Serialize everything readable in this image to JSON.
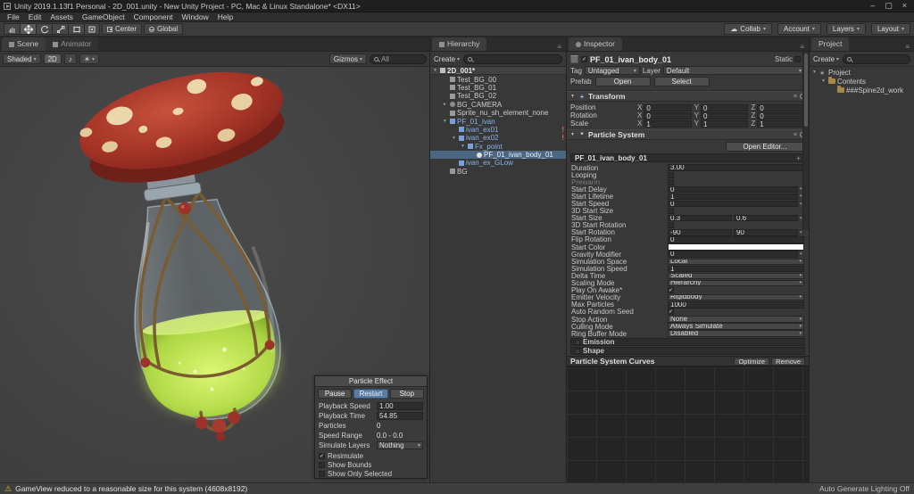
{
  "window": {
    "title": "Unity 2019.1.13f1 Personal - 2D_001.unity - New Unity Project - PC, Mac & Linux Standalone* <DX11>",
    "menus": [
      {
        "label": "File"
      },
      {
        "label": "Edit"
      },
      {
        "label": "Assets"
      },
      {
        "label": "GameObject"
      },
      {
        "label": "Component"
      },
      {
        "label": "Window"
      },
      {
        "label": "Help"
      }
    ],
    "controls": {
      "minimize": "–",
      "maximize": "▢",
      "close": "×"
    }
  },
  "toolbar": {
    "tools": [
      "hand-tool",
      "move-tool",
      "rotate-tool",
      "scale-tool",
      "rect-tool",
      "transform-tool"
    ],
    "pivot_label": "Center",
    "space_label": "Global",
    "collab_label": "Collab",
    "account_label": "Account",
    "layers_label": "Layers",
    "layout_label": "Layout"
  },
  "scene": {
    "tabs": [
      {
        "label": "Scene",
        "active": true
      },
      {
        "label": "Animator",
        "active": false
      }
    ],
    "toolbar": {
      "shading_mode": "Shaded",
      "mode_2d": "2D",
      "gizmos_label": "Gizmos",
      "search_value": "All"
    }
  },
  "particle_effect": {
    "title": "Particle Effect",
    "buttons": [
      {
        "label": "Pause",
        "active": false
      },
      {
        "label": "Restart",
        "active": true
      },
      {
        "label": "Stop",
        "active": false
      }
    ],
    "rows": [
      {
        "label": "Playback Speed",
        "value": "1.00",
        "field": "text"
      },
      {
        "label": "Playback Time",
        "value": "54.85",
        "field": "text"
      },
      {
        "label": "Particles",
        "value": "0",
        "field": "plain"
      },
      {
        "label": "Speed Range",
        "value": "0.0 - 0.0",
        "field": "plain"
      },
      {
        "label": "Simulate Layers",
        "value": "Nothing",
        "field": "dropdown"
      }
    ],
    "checks": [
      {
        "label": "Resimulate",
        "checked": true
      },
      {
        "label": "Show Bounds",
        "checked": false
      },
      {
        "label": "Show Only Selected",
        "checked": false
      }
    ]
  },
  "hierarchy": {
    "tab": "Hierarchy",
    "create_label": "Create",
    "items": [
      {
        "label": "2D_001*",
        "depth": 0,
        "arrow": "down",
        "icon": "scene",
        "type": "scene"
      },
      {
        "label": "Test_BG_00",
        "depth": 1,
        "icon": "go"
      },
      {
        "label": "Test_BG_01",
        "depth": 1,
        "icon": "go"
      },
      {
        "label": "Test_BG_02",
        "depth": 1,
        "icon": "go"
      },
      {
        "label": "BG_CAMERA",
        "depth": 1,
        "arrow": "right",
        "icon": "camera"
      },
      {
        "label": "Sprite_nu_sh_element_none",
        "depth": 1,
        "icon": "go"
      },
      {
        "label": "PF_01_ivan",
        "depth": 1,
        "arrow": "down",
        "icon": "prefab",
        "prefab": true
      },
      {
        "label": "ivan_ex01",
        "depth": 2,
        "icon": "prefab",
        "prefab": true,
        "warning": true
      },
      {
        "label": "ivan_ex02",
        "depth": 2,
        "arrow": "down",
        "icon": "prefab",
        "prefab": true,
        "warning": true
      },
      {
        "label": "Fx_point",
        "depth": 3,
        "arrow": "down",
        "icon": "prefab",
        "prefab": true
      },
      {
        "label": "PF_01_ivan_body_01",
        "depth": 4,
        "icon": "particle",
        "prefab": true,
        "selected": true
      },
      {
        "label": "ivan_ex_GLow",
        "depth": 2,
        "icon": "prefab",
        "prefab": true
      },
      {
        "label": "BG",
        "depth": 1,
        "icon": "go"
      }
    ]
  },
  "inspector": {
    "tab": "Inspector",
    "object_name": "PF_01_ivan_body_01",
    "static_label": "Static",
    "tag_label": "Tag",
    "tag_value": "Untagged",
    "layer_label": "Layer",
    "layer_value": "Default",
    "prefab_label": "Prefab",
    "prefab_buttons": [
      {
        "label": "Open"
      },
      {
        "label": "Select"
      }
    ],
    "transform": {
      "title": "Transform",
      "axes": [
        "X",
        "Y",
        "Z"
      ],
      "rows": [
        {
          "label": "Position",
          "x": "0",
          "y": "0",
          "z": "0"
        },
        {
          "label": "Rotation",
          "x": "0",
          "y": "0",
          "z": "0"
        },
        {
          "label": "Scale",
          "x": "1",
          "y": "1",
          "z": "1"
        }
      ]
    },
    "particle_system": {
      "title": "Particle System",
      "open_editor_label": "Open Editor...",
      "module_title": "PF_01_ivan_body_01",
      "properties": [
        {
          "label": "Duration",
          "type": "text",
          "value": "3.00"
        },
        {
          "label": "Looping",
          "type": "checkbox",
          "checked": false
        },
        {
          "label": "Prewarm",
          "type": "checkbox",
          "checked": false,
          "disabled": true
        },
        {
          "label": "Start Delay",
          "type": "text-arrow",
          "value": "0"
        },
        {
          "label": "Start Lifetime",
          "type": "text-arrow",
          "value": "1"
        },
        {
          "label": "Start Speed",
          "type": "text-arrow",
          "value": "0"
        },
        {
          "label": "3D Start Size",
          "type": "checkbox",
          "checked": false
        },
        {
          "label": "Start Size",
          "type": "two-text-arrow",
          "value": "0.3",
          "value2": "0.6"
        },
        {
          "label": "3D Start Rotation",
          "type": "checkbox",
          "checked": false
        },
        {
          "label": "Start Rotation",
          "type": "two-text-arrow",
          "value": "-90",
          "value2": "90"
        },
        {
          "label": "Flip Rotation",
          "type": "text",
          "value": "0"
        },
        {
          "label": "Start Color",
          "type": "color"
        },
        {
          "label": "Gravity Modifier",
          "type": "text-arrow",
          "value": "0"
        },
        {
          "label": "Simulation Space",
          "type": "dropdown",
          "value": "Local"
        },
        {
          "label": "Simulation Speed",
          "type": "text",
          "value": "1"
        },
        {
          "label": "Delta Time",
          "type": "dropdown",
          "value": "Scaled"
        },
        {
          "label": "Scaling Mode",
          "type": "dropdown",
          "value": "Hierarchy"
        },
        {
          "label": "Play On Awake*",
          "type": "checkbox",
          "checked": true
        },
        {
          "label": "Emitter Velocity",
          "type": "dropdown",
          "value": "Rigidbody"
        },
        {
          "label": "Max Particles",
          "type": "text",
          "value": "1000"
        },
        {
          "label": "Auto Random Seed",
          "type": "checkbox",
          "checked": true
        },
        {
          "label": "Stop Action",
          "type": "dropdown",
          "value": "None"
        },
        {
          "label": "Culling Mode",
          "type": "dropdown",
          "value": "Always Simulate"
        },
        {
          "label": "Ring Buffer Mode",
          "type": "dropdown",
          "value": "Disabled"
        }
      ],
      "modules": [
        {
          "label": "Emission"
        },
        {
          "label": "Shape"
        }
      ]
    },
    "curves": {
      "title": "Particle System Curves",
      "buttons": [
        {
          "label": "Optimize"
        },
        {
          "label": "Remove"
        }
      ]
    }
  },
  "project": {
    "tab": "Project",
    "create_label": "Create",
    "items": [
      {
        "label": "Project",
        "depth": 0,
        "arrow": "down",
        "icon": "star"
      },
      {
        "label": "Contents",
        "depth": 1,
        "arrow": "down",
        "icon": "folder"
      },
      {
        "label": "###Spine2d_work",
        "depth": 2,
        "icon": "folder"
      }
    ]
  },
  "statusbar": {
    "message": "GameView reduced to a reasonable size for this system (4608x8192)",
    "right_label": "Auto Generate Lighting Off"
  },
  "colors": {
    "selection": "#4c6782",
    "prefab_text": "#88b4e7",
    "warning_red": "#ff5a52",
    "restart_active": "#5b7ca3"
  }
}
